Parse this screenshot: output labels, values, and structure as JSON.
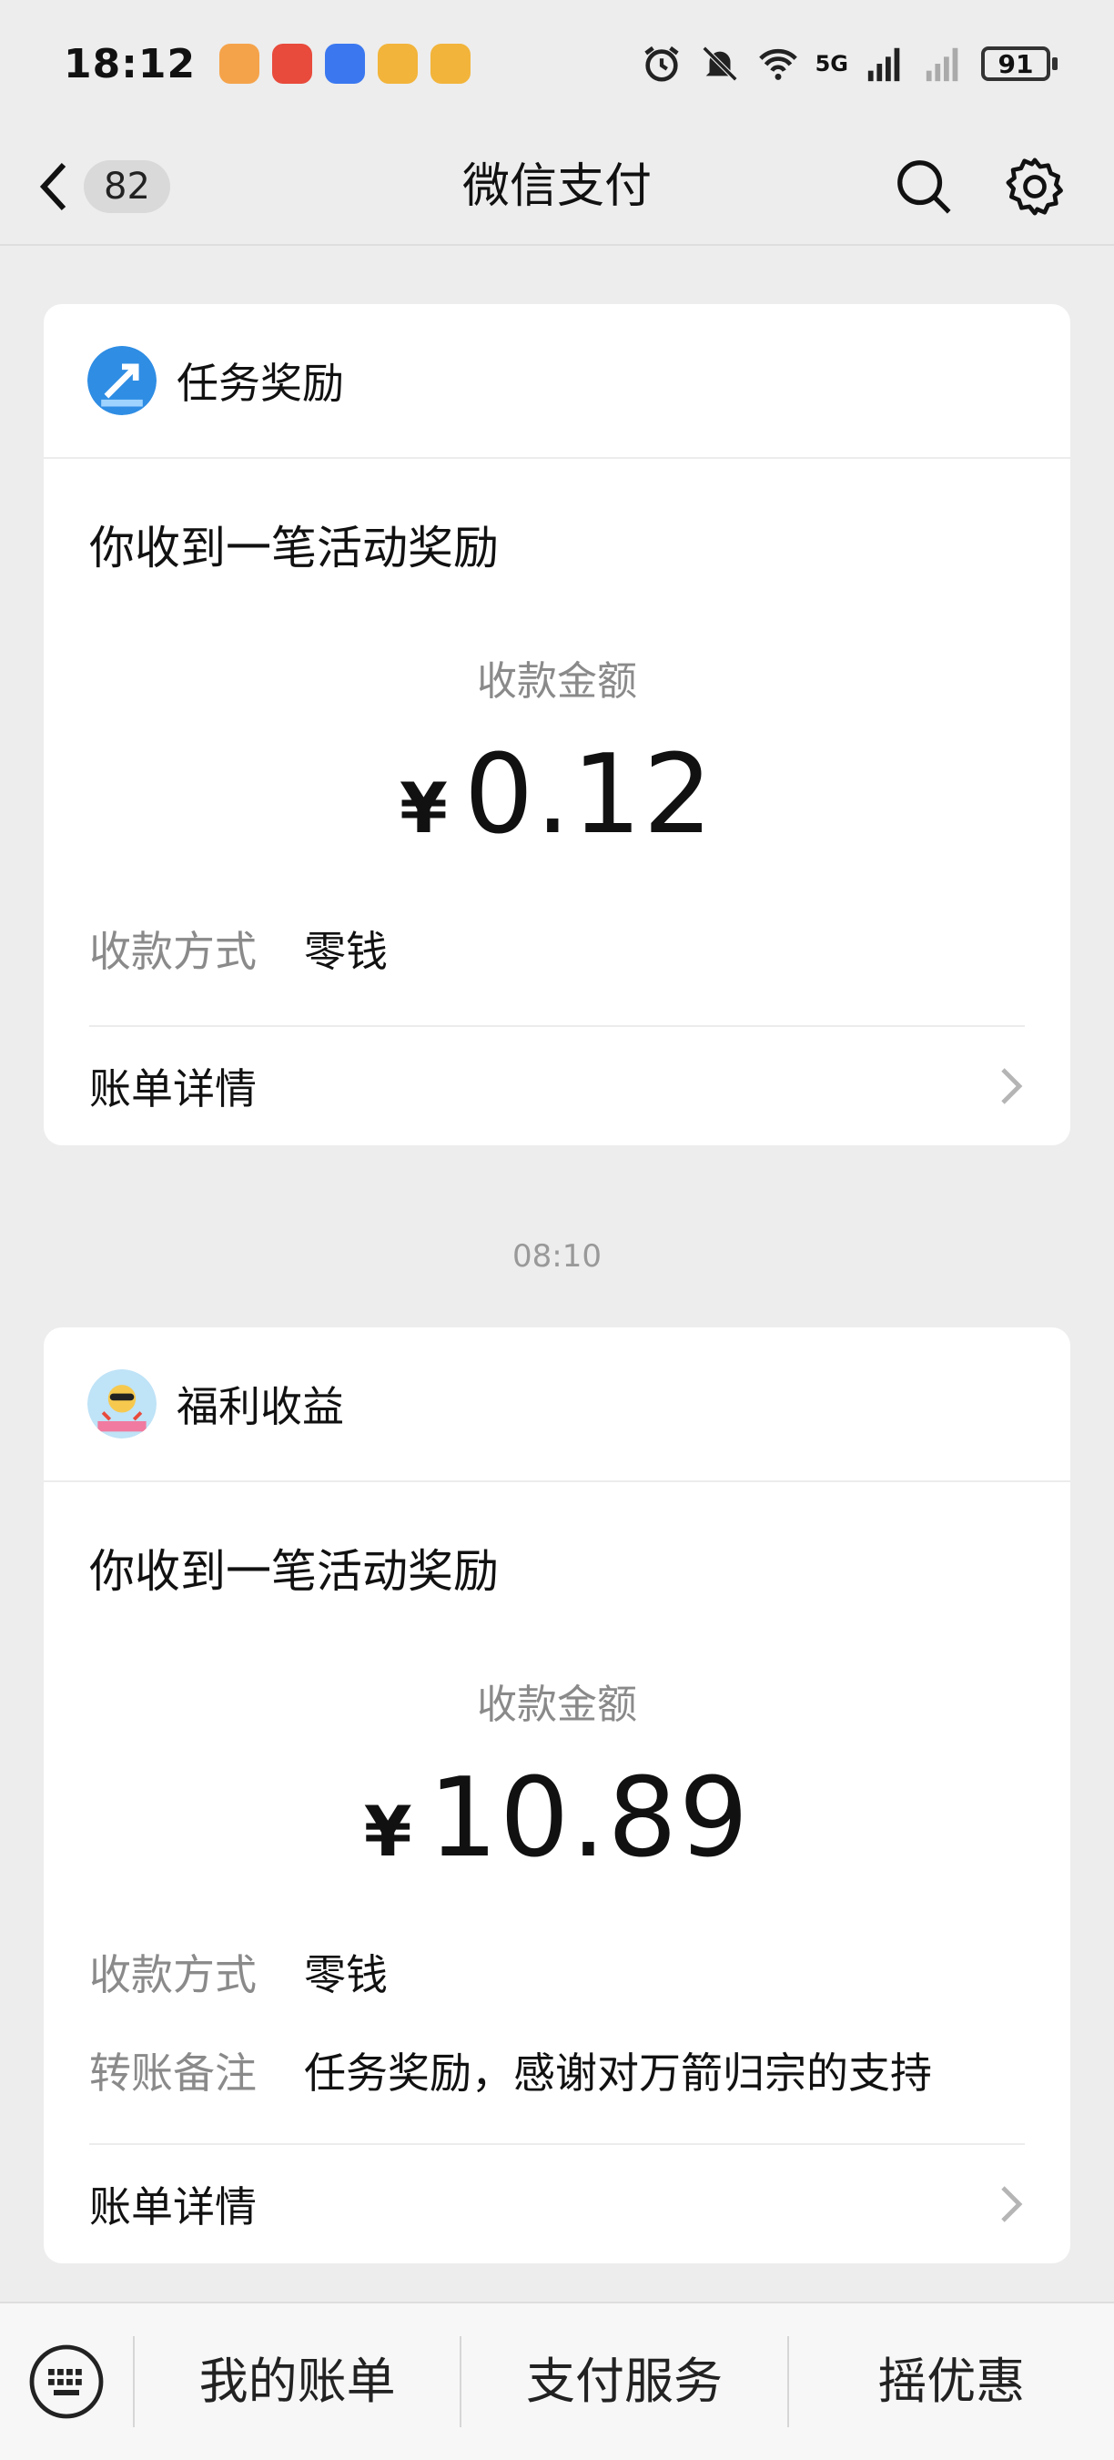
{
  "status_bar": {
    "time": "18:12",
    "network": "5G",
    "battery": "91",
    "app_colors": [
      "#f5a34a",
      "#e84a3b",
      "#3b78f0",
      "#f2b43a",
      "#f2b43a"
    ]
  },
  "header": {
    "unread_count": "82",
    "title": "微信支付"
  },
  "cards": [
    {
      "sender": "任务奖励",
      "title": "你收到一笔活动奖励",
      "amount_label": "收款金额",
      "currency": "¥",
      "amount": "0.12",
      "rows": [
        {
          "label": "收款方式",
          "value": "零钱"
        }
      ],
      "detail_label": "账单详情"
    },
    {
      "sender": "福利收益",
      "title": "你收到一笔活动奖励",
      "amount_label": "收款金额",
      "currency": "¥",
      "amount": "10.89",
      "rows": [
        {
          "label": "收款方式",
          "value": "零钱"
        },
        {
          "label": "转账备注",
          "value": "任务奖励，感谢对万箭归宗的支持"
        }
      ],
      "detail_label": "账单详情"
    }
  ],
  "time_separator": "08:10",
  "bottom_menu": {
    "items": [
      "我的账单",
      "支付服务",
      "摇优惠"
    ]
  }
}
